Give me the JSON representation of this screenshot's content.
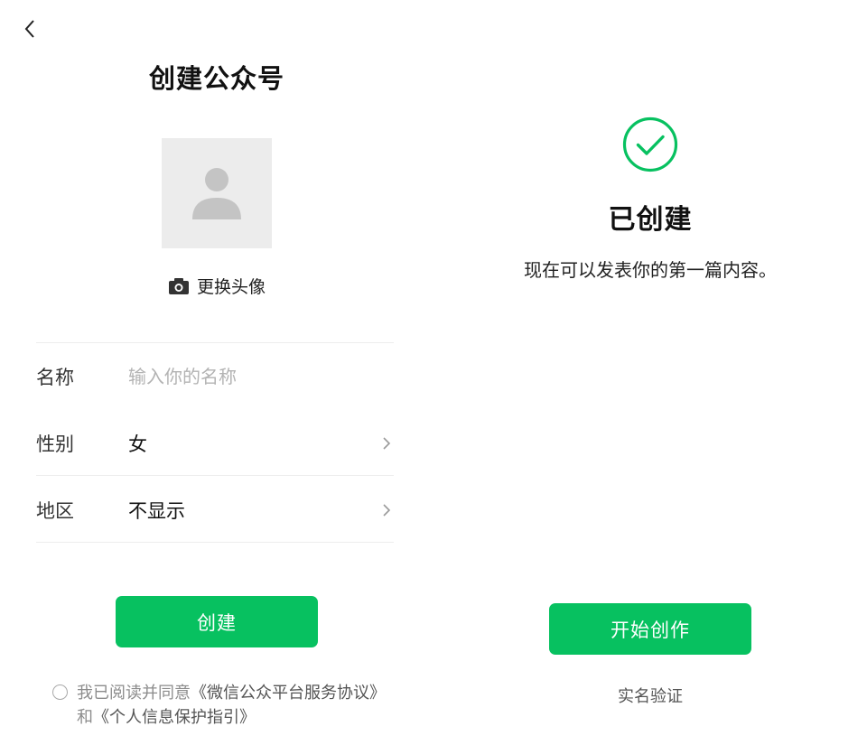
{
  "create_page": {
    "title": "创建公众号",
    "change_avatar_label": "更换头像",
    "form": {
      "name": {
        "label": "名称",
        "placeholder": "输入你的名称",
        "value": ""
      },
      "gender": {
        "label": "性别",
        "value": "女"
      },
      "region": {
        "label": "地区",
        "value": "不显示"
      }
    },
    "create_button": "创建",
    "agreement": {
      "prefix": "我已阅读并同意",
      "service_link": "《微信公众平台服务协议》",
      "and": "和",
      "privacy_link": "《个人信息保护指引》",
      "checked": false
    }
  },
  "success_page": {
    "title": "已创建",
    "subtitle": "现在可以发表你的第一篇内容。",
    "start_button": "开始创作",
    "verify_link": "实名验证"
  },
  "icons": {
    "back": "chevron-left-icon",
    "avatar": "person-placeholder-icon",
    "camera": "camera-icon",
    "chevron": "chevron-right-icon",
    "success": "check-circle-icon"
  },
  "colors": {
    "accent": "#07c160",
    "avatar_bg": "#ececec",
    "divider": "#ededed",
    "muted_text": "#8c8c8c"
  }
}
